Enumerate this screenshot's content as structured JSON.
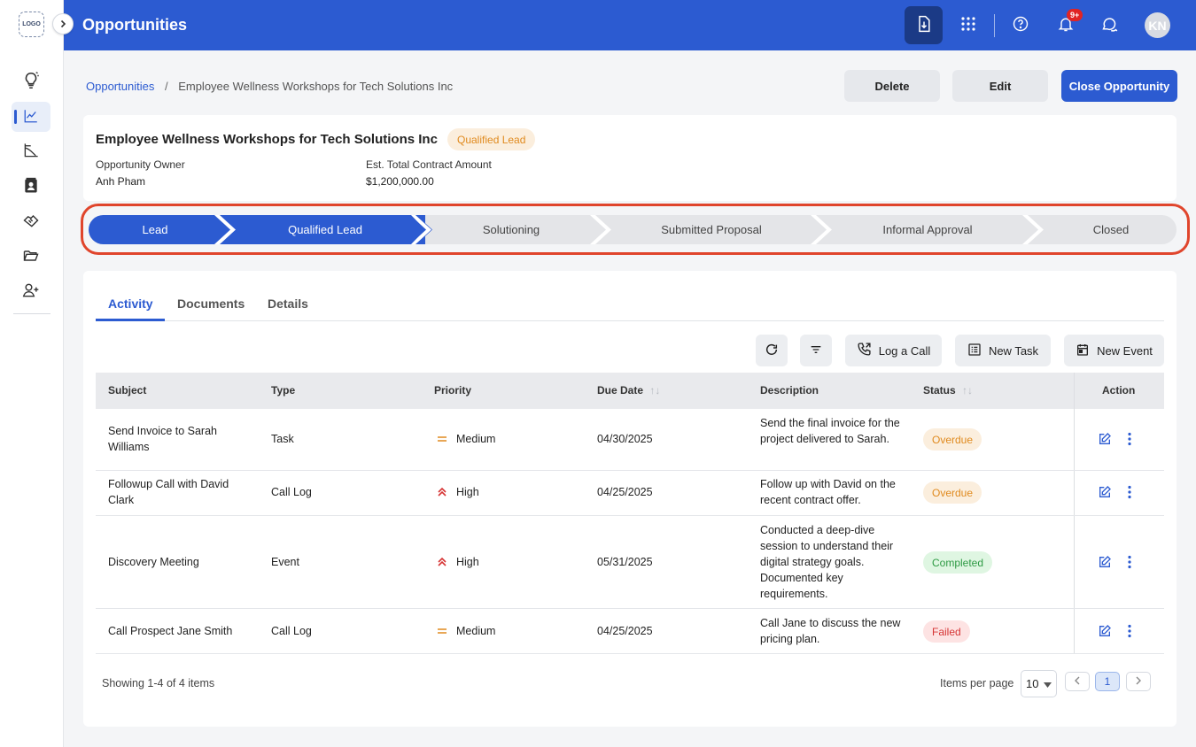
{
  "app": {
    "logo_text": "LOGO",
    "page_title": "Opportunities",
    "notification_count": "9+",
    "user_initials": "KN",
    "accent": "#2c5bd1"
  },
  "sidebar": {
    "items": [
      {
        "icon": "lightbulb-icon",
        "active": false
      },
      {
        "icon": "trending-chart-icon",
        "active": true
      },
      {
        "icon": "line-chart-icon",
        "active": false
      },
      {
        "icon": "contact-card-icon",
        "active": false
      },
      {
        "icon": "handshake-icon",
        "active": false
      },
      {
        "icon": "folder-open-icon",
        "active": false
      },
      {
        "icon": "add-user-icon",
        "active": false
      }
    ]
  },
  "breadcrumb": {
    "root": "Opportunities",
    "current": "Employee Wellness Workshops for Tech Solutions Inc"
  },
  "actions": {
    "delete": "Delete",
    "edit": "Edit",
    "close": "Close Opportunity"
  },
  "opportunity": {
    "name": "Employee Wellness Workshops for Tech Solutions Inc",
    "stage": "Qualified Lead",
    "owner_label": "Opportunity Owner",
    "owner": "Anh Pham",
    "amount_label": "Est. Total Contract Amount",
    "amount": "$1,200,000.00"
  },
  "stages": [
    {
      "label": "Lead",
      "done": true
    },
    {
      "label": "Qualified Lead",
      "done": true
    },
    {
      "label": "Solutioning",
      "done": false
    },
    {
      "label": "Submitted Proposal",
      "done": false
    },
    {
      "label": "Informal Approval",
      "done": false
    },
    {
      "label": "Closed",
      "done": false
    }
  ],
  "tabs": [
    {
      "label": "Activity",
      "active": true
    },
    {
      "label": "Documents",
      "active": false
    },
    {
      "label": "Details",
      "active": false
    }
  ],
  "toolbar": {
    "log_call": "Log a Call",
    "new_task": "New Task",
    "new_event": "New Event"
  },
  "table": {
    "columns": [
      "Subject",
      "Type",
      "Priority",
      "Due Date",
      "Description",
      "Status",
      "Action"
    ],
    "rows": [
      {
        "subject": "Send Invoice to Sarah Williams",
        "type": "Task",
        "priority": "Medium",
        "due": "04/30/2025",
        "description": "Send the final invoice for the project delivered to Sarah.",
        "status": "Overdue"
      },
      {
        "subject": "Followup Call with David Clark",
        "type": "Call Log",
        "priority": "High",
        "due": "04/25/2025",
        "description": "Follow up with David on the recent contract offer.",
        "status": "Overdue"
      },
      {
        "subject": "Discovery Meeting",
        "type": "Event",
        "priority": "High",
        "due": "05/31/2025",
        "description": "Conducted a deep-dive session to understand their digital strategy goals. Documented key requirements.",
        "status": "Completed"
      },
      {
        "subject": "Call Prospect Jane Smith",
        "type": "Call Log",
        "priority": "Medium",
        "due": "04/25/2025",
        "description": "Call Jane to discuss the new pricing plan.",
        "status": "Failed"
      }
    ]
  },
  "pagination": {
    "summary": "Showing 1-4 of 4 items",
    "per_page_label": "Items per page",
    "per_page": "10",
    "current_page": "1"
  },
  "colors": {
    "stage_done": "#2c5bd1",
    "stage_pending": "#e4e5e8",
    "highlight_outline": "#e0452c",
    "overdue": "#e08a1e",
    "completed": "#2e9a44",
    "failed": "#d63434"
  }
}
